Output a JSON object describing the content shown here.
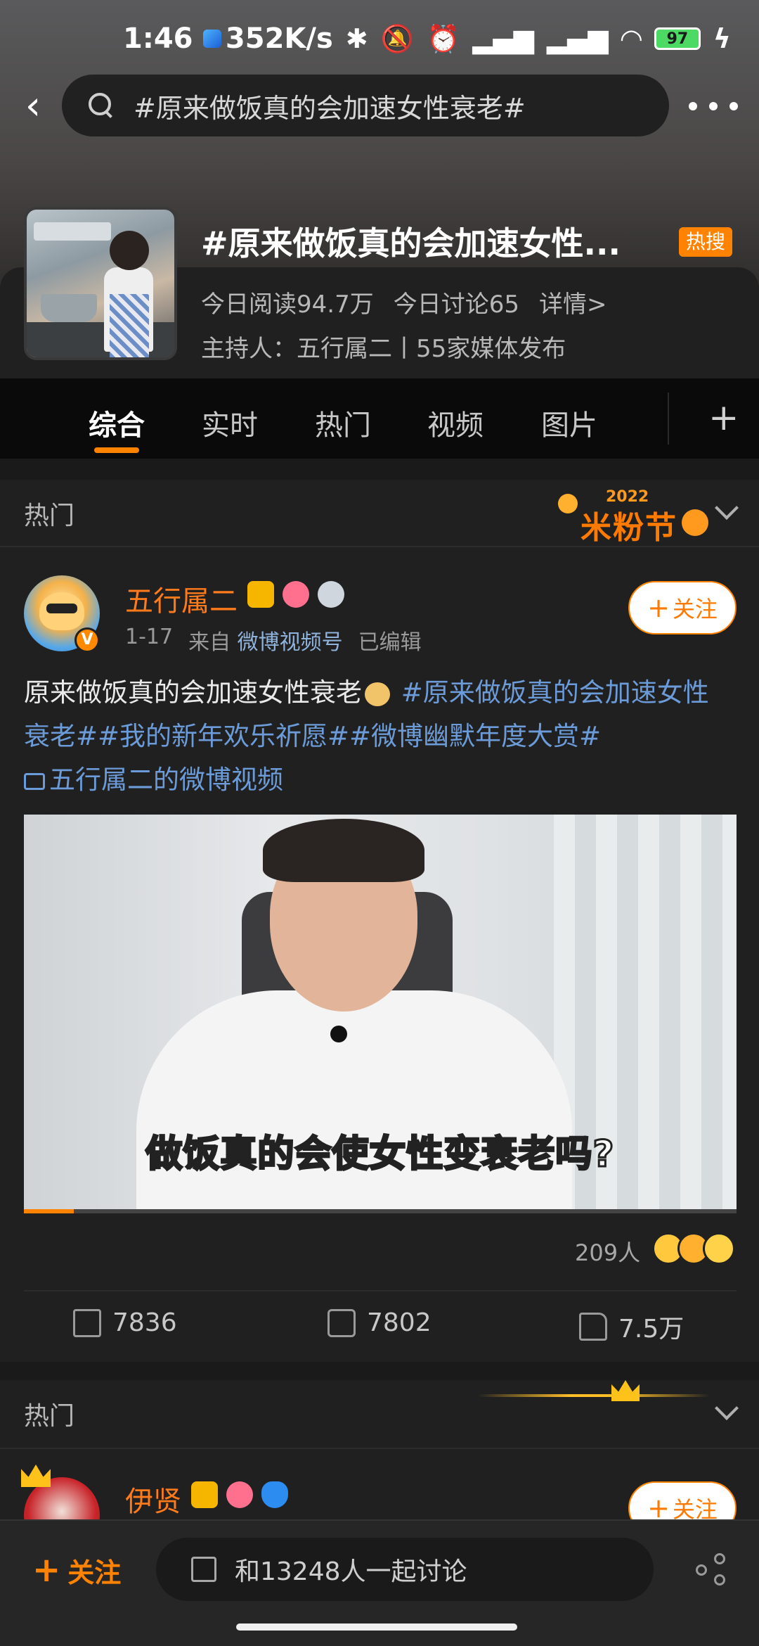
{
  "status_bar": {
    "time": "1:46",
    "net_speed": "352K/s",
    "battery": "97"
  },
  "search": {
    "query": "#原来做饭真的会加速女性衰老#"
  },
  "topic": {
    "title": "#原来做饭真的会加速女性...",
    "hot_badge": "热搜",
    "reads": "今日阅读94.7万",
    "discussions": "今日讨论65",
    "details": "详情>",
    "host": "主持人：五行属二丨55家媒体发布"
  },
  "tabs": [
    "综合",
    "实时",
    "热门",
    "视频",
    "图片"
  ],
  "section1": {
    "label": "热门",
    "promo_year": "2022",
    "promo_name": "米粉节"
  },
  "post": {
    "username": "五行属二",
    "date": "1-17",
    "source_prefix": "来自",
    "source": "微博视频号",
    "edited": "已编辑",
    "follow_label": "关注",
    "text_plain": "原来做饭真的会加速女性衰老",
    "tag1": "#原来做饭真的会加速女性衰老#",
    "tag2": "#我的新年欢乐祈愿#",
    "tag3": "#微博幽默年度大赏#",
    "video_link": "五行属二的微博视频",
    "video_caption": "做饭真的会使女性变衰老吗?",
    "video_progress": 0.07,
    "reaction_count": "209人",
    "reposts": "7836",
    "comments": "7802",
    "likes": "7.5万"
  },
  "section2": {
    "label": "热门"
  },
  "post2": {
    "username": "伊贤",
    "follow_label": "关注"
  },
  "bottom_bar": {
    "follow_label": "关注",
    "input_placeholder": "和13248人一起讨论"
  },
  "colors": {
    "accent": "#ff8200",
    "username": "#ff7a1a",
    "link": "#6b9bd8"
  }
}
